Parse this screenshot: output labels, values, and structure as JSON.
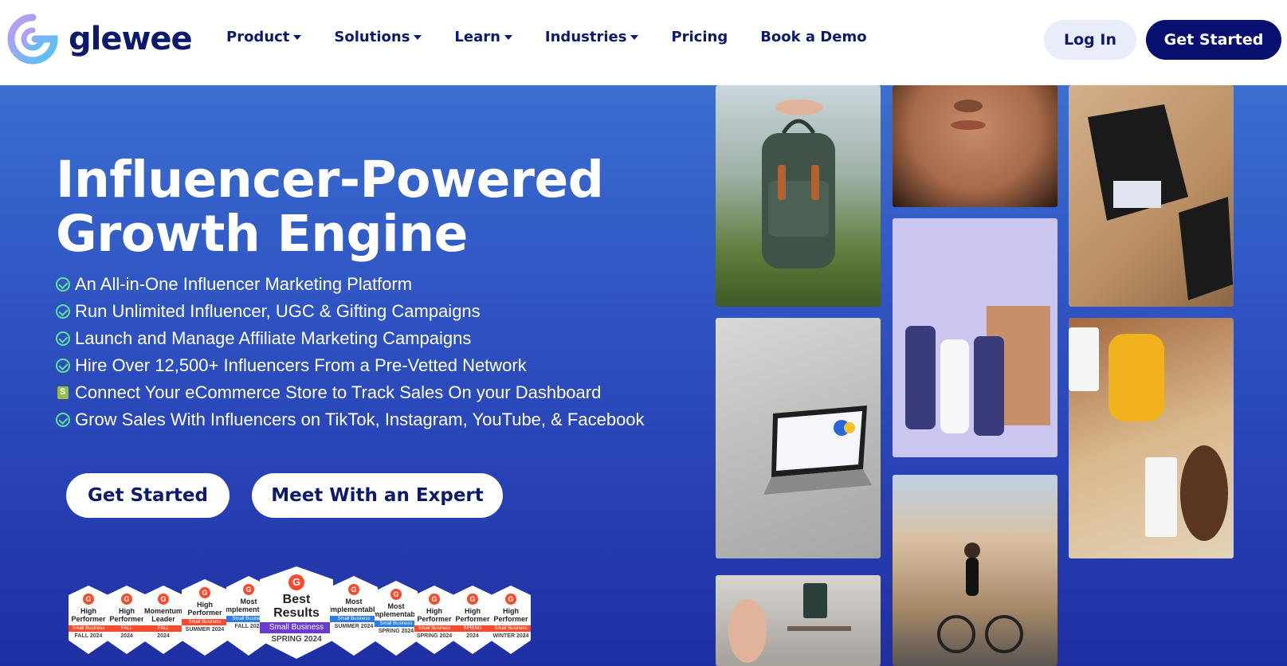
{
  "brand": {
    "name": "glewee"
  },
  "nav": {
    "items": [
      {
        "label": "Product",
        "dropdown": true
      },
      {
        "label": "Solutions",
        "dropdown": true
      },
      {
        "label": "Learn",
        "dropdown": true
      },
      {
        "label": "Industries",
        "dropdown": true
      },
      {
        "label": "Pricing",
        "dropdown": false
      },
      {
        "label": "Book a Demo",
        "dropdown": false
      }
    ],
    "login_label": "Log In",
    "get_started_label": "Get Started"
  },
  "hero": {
    "headline_line1": "Influencer-Powered",
    "headline_line2": "Growth Engine",
    "features": [
      {
        "text": "An All-in-One Influencer Marketing Platform",
        "icon": "check-circle-icon"
      },
      {
        "text": "Run Unlimited Influencer, UGC & Gifting Campaigns",
        "icon": "check-circle-icon"
      },
      {
        "text": "Launch and Manage Affiliate Marketing Campaigns",
        "icon": "check-circle-icon"
      },
      {
        "text": "Hire Over 12,500+ Influencers From a Pre-Vetted Network",
        "icon": "check-circle-icon"
      },
      {
        "text": "Connect Your eCommerce Store to Track Sales On your Dashboard",
        "icon": "shopify-bag-icon"
      },
      {
        "text": "Grow Sales With Influencers on TikTok, Instagram, YouTube, & Facebook",
        "icon": "check-circle-icon"
      }
    ],
    "cta_primary": "Get Started",
    "cta_secondary": "Meet With an Expert"
  },
  "badges": [
    {
      "title": "High Performer",
      "stripe": "Small Business",
      "season": "FALL 2024"
    },
    {
      "title": "High Performer",
      "stripe": "FALL",
      "season": "2024"
    },
    {
      "title": "Momentum Leader",
      "stripe": "FALL",
      "season": "2024"
    },
    {
      "title": "High Performer",
      "stripe": "Small Business",
      "season": "SUMMER 2024"
    },
    {
      "title": "Most Implementable",
      "stripe": "Small Business",
      "season": "FALL 2024"
    },
    {
      "title": "Best Results",
      "stripe": "Small Business",
      "season": "SPRING 2024"
    },
    {
      "title": "Most Implementable",
      "stripe": "Small Business",
      "season": "SUMMER 2024"
    },
    {
      "title": "Most Implementable",
      "stripe": "Small Business",
      "season": "SPRING 2024"
    },
    {
      "title": "High Performer",
      "stripe": "Small Business",
      "season": "SPRING 2024"
    },
    {
      "title": "High Performer",
      "stripe": "SPRING",
      "season": "2024"
    },
    {
      "title": "High Performer",
      "stripe": "Small Business",
      "season": "WINTER 2024"
    }
  ],
  "colors": {
    "navy": "#0b1a6b",
    "hero_top": "#3a6fd0",
    "hero_bottom": "#1e2fa3",
    "check": "#5fe29a",
    "g2_red": "#ff492c"
  }
}
